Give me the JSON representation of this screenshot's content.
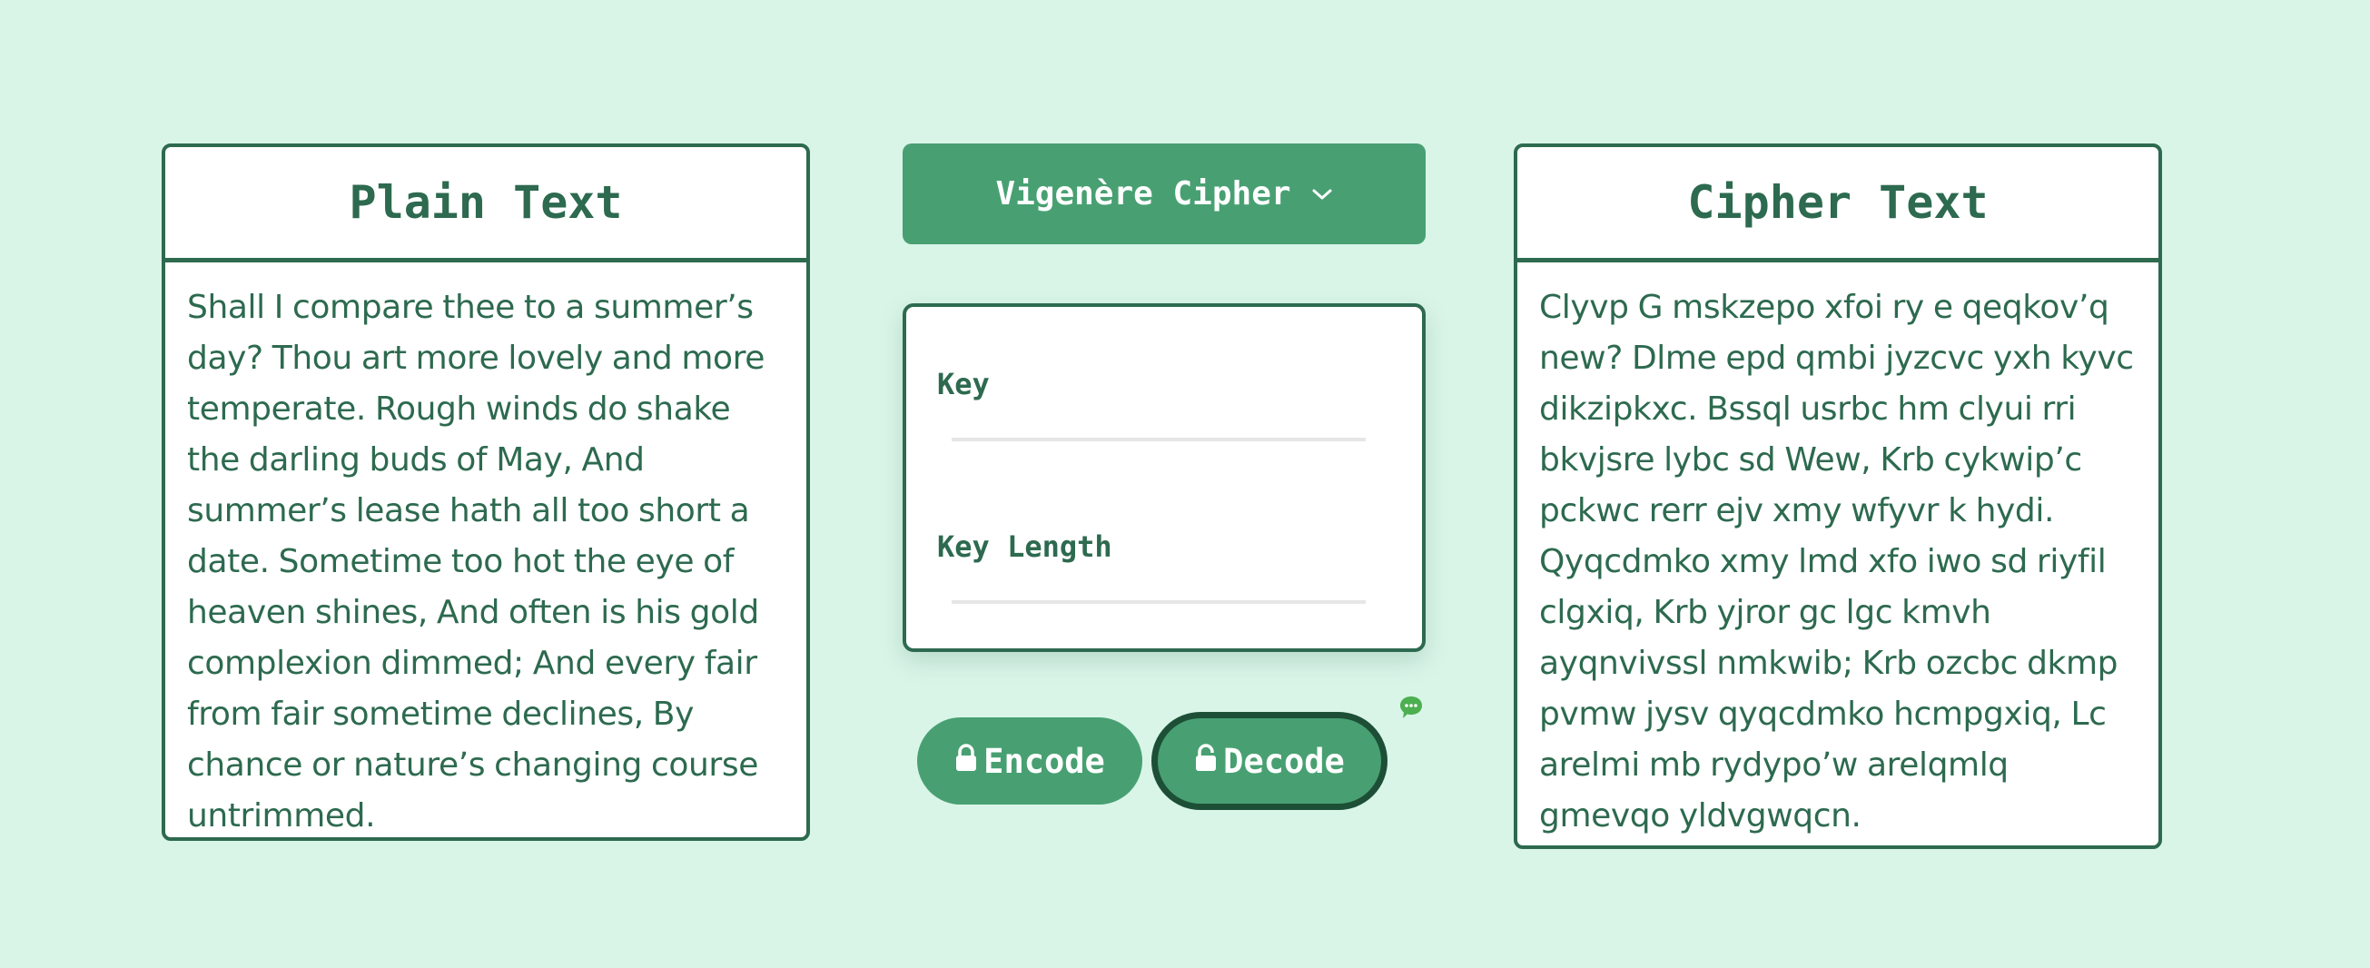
{
  "plain_panel": {
    "title": "Plain Text",
    "text": "Shall I compare thee to a summer’s day? Thou art more lovely and more temperate. Rough winds do shake the darling buds of May, And summer’s lease hath all too short a date. Sometime too hot the eye of heaven shines, And often is his gold complexion dimmed; And every fair from fair sometime declines, By chance or nature’s changing course untrimmed."
  },
  "cipher_panel": {
    "title": "Cipher Text",
    "text": "Clyvp G mskzepo xfoi ry e qeqkov’q new? Dlme epd qmbi jyzcvc yxh kyvc dikzipkxc. Bssql usrbc hm clyui rri bkvjsre lybc sd Wew, Krb cykwip’c pckwc rerr ejv xmy wfyvr k hydi. Qyqcdmko xmy lmd xfo iwo sd riyfil clgxiq, Krb yjror gc lgc kmvh ayqnvivssl nmkwib; Krb ozcbc dkmp pvmw jysv qyqcdmko hcmpgxiq, Lc arelmi mb rydypo’w arelqmlq gmevqo yldvgwqcn."
  },
  "cipher_selector": {
    "label": "Vigenère Cipher",
    "icon": "chevron-down-icon"
  },
  "key_card": {
    "key_label": "Key",
    "key_value": "",
    "key_length_label": "Key Length",
    "key_length_value": ""
  },
  "actions": {
    "encode_label": "Encode",
    "decode_label": "Decode",
    "encode_icon": "lock-icon",
    "decode_icon": "unlock-icon"
  },
  "colors": {
    "background": "#d9f5e8",
    "primary": "#48a072",
    "dark": "#2d6a4f",
    "chat_icon": "#4caf50"
  }
}
